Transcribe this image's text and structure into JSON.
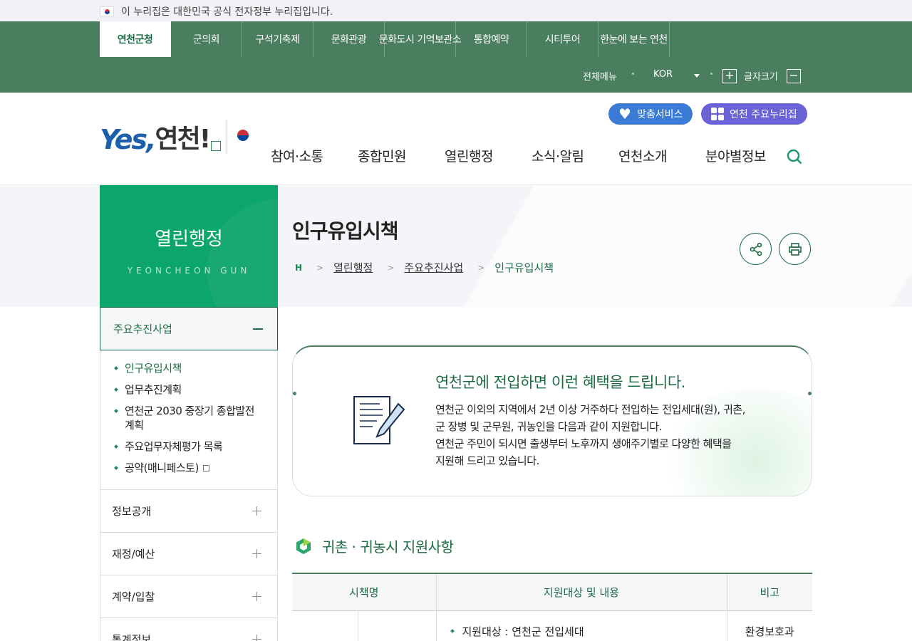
{
  "gov_banner": {
    "text": "이 누리집은 대한민국 공식 전자정부 누리집입니다."
  },
  "family_sites": [
    {
      "label": "연천군청"
    },
    {
      "label": "군의회"
    },
    {
      "label": "구석기축제"
    },
    {
      "label": "문화관광"
    },
    {
      "label": "문화도시 기억보관소"
    },
    {
      "label": "통합예약"
    },
    {
      "label": "시티투어"
    },
    {
      "label": "한눈에 보는 연천"
    }
  ],
  "util": {
    "all_menu": "전체메뉴",
    "language": "KOR",
    "font_size": "글자크기",
    "plus": "+",
    "minus": "−"
  },
  "logo": {
    "text_yes": "Yes,",
    "text_name": "연천!"
  },
  "services": {
    "custom": "맞춤서비스",
    "main_sites": "연천 주요누리집"
  },
  "gnb": [
    "참여·소통",
    "종합민원",
    "열린행정",
    "소식·알림",
    "연천소개",
    "분야별정보"
  ],
  "lnb": {
    "title": "열린행정",
    "subtitle": "YEONCHEON GUN",
    "open_menu": "주요추진사업",
    "sub_items": [
      "인구유입시책",
      "업무추진계획",
      "연천군 2030 중장기 종합발전계획",
      "주요업무자체평가 목록",
      "공약(매니페스토)"
    ],
    "menu_items": [
      "정보공개",
      "재정/예산",
      "계약/입찰",
      "통계정보"
    ]
  },
  "page": {
    "title": "인구유입시책",
    "breadcrumb": {
      "home": "H",
      "items": [
        "열린행정",
        "주요추진사업",
        "인구유입시책"
      ]
    }
  },
  "info": {
    "heading": "연천군에 전입하면 이런 혜택을 드립니다.",
    "lines": [
      "연천군 이외의 지역에서 2년 이상 거주하다 전입하는 전입세대(원), 귀촌,",
      "군 장병 및 군무원, 귀농인을 다음과 같이 지원합니다.",
      "연천군 주민이 되시면 출생부터 노후까지 생애주기별로 다양한 혜택을",
      "지원해 드리고 있습니다."
    ]
  },
  "section": {
    "title": "귀촌 · 귀농시 지원사항"
  },
  "table": {
    "headers": [
      "시책명",
      "지원대상 및 내용",
      "비고"
    ],
    "row": {
      "c1": "",
      "c2": "",
      "content": "지원대상 : 연천군 전입세대",
      "note": "환경보호과"
    }
  },
  "colors": {
    "primary": "#4a7e5f",
    "accent": "#0ca56c",
    "blue": "#3a7bd5",
    "purple": "#6a63d8"
  }
}
